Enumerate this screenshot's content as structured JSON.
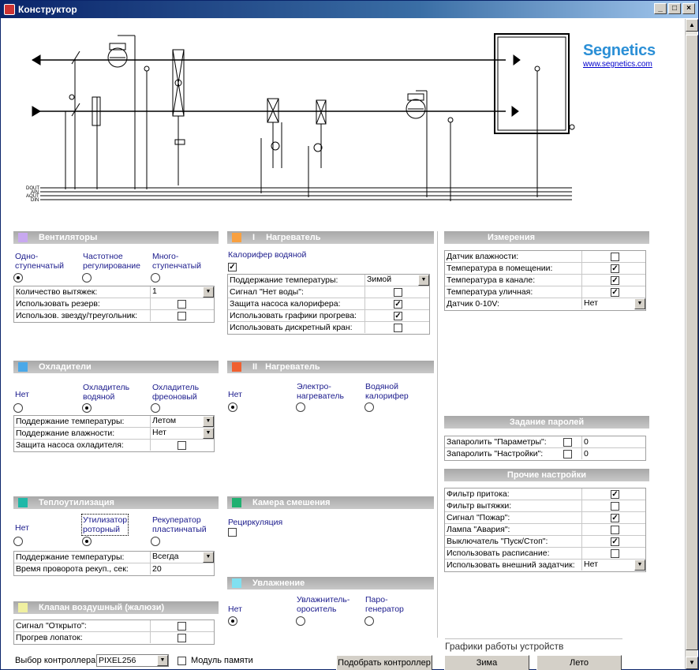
{
  "window": {
    "title": "Конструктор",
    "min": "_",
    "max": "□",
    "close": "×"
  },
  "brand": {
    "name": "Segnetics",
    "url": "www.segnetics.com"
  },
  "schema": {
    "bus_labels": [
      "DOUT",
      "AIN",
      "AOUT",
      "DIN"
    ]
  },
  "fans": {
    "title": "Вентиляторы",
    "color": "#c8a8f0",
    "options": [
      "Одно-\nступенчатый",
      "Частотное\nрегулирование",
      "Много-\nступенчатый"
    ],
    "rows": [
      {
        "label": "Количество вытяжек:",
        "value": "1"
      },
      {
        "label": "Использовать резерв:"
      },
      {
        "label": "Использов. звезду/треугольник:"
      }
    ]
  },
  "coolers": {
    "title": "Охладители",
    "color": "#4aa8e8",
    "options": [
      "Нет",
      "Охладитель\nводяной",
      "Охладитель\nфреоновый"
    ],
    "rows": [
      {
        "label": "Поддержание температуры:",
        "value": "Летом"
      },
      {
        "label": "Поддержание влажности:",
        "value": "Нет"
      },
      {
        "label": "Защита насоса охладителя:"
      }
    ]
  },
  "heatrec": {
    "title": "Теплоутилизация",
    "color": "#20b8a8",
    "options": [
      "Нет",
      "Утилизатор\nроторный",
      "Рекуператор\nпластинчатый"
    ],
    "rows": [
      {
        "label": "Поддержание температуры:",
        "value": "Всегда"
      },
      {
        "label": "Время проворота рекуп., сек:",
        "value": "20"
      }
    ]
  },
  "damper": {
    "title": "Клапан воздушный (жалюзи)",
    "color": "#f0f0a0",
    "rows": [
      {
        "label": "Сигнал \"Открыто\":"
      },
      {
        "label": "Прогрев лопаток:"
      }
    ]
  },
  "heater1": {
    "num": "I",
    "title": "Нагреватель",
    "color": "#f8a040",
    "sub": "Калорифер водяной",
    "rows": [
      {
        "label": "Поддержание температуры:",
        "value": "Зимой"
      },
      {
        "label": "Сигнал \"Нет воды\":"
      },
      {
        "label": "Защита насоса калорифера:"
      },
      {
        "label": "Использовать графики прогрева:"
      },
      {
        "label": "Использовать дискретный кран:"
      }
    ]
  },
  "heater2": {
    "num": "II",
    "title": "Нагреватель",
    "color": "#f06030",
    "options": [
      "Нет",
      "Электро-\nнагреватель",
      "Водяной\nкалорифер"
    ]
  },
  "mixing": {
    "title": "Камера смешения",
    "color": "#20b070",
    "sub": "Рециркуляция"
  },
  "humid": {
    "title": "Увлажнение",
    "color": "#80e0f0",
    "options": [
      "Нет",
      "Увлажнитель-\nороситель",
      "Паро-\nгенератор"
    ]
  },
  "measure": {
    "title": "Измерения",
    "rows": [
      {
        "label": "Датчик влажности:"
      },
      {
        "label": "Температура в помещении:"
      },
      {
        "label": "Температура в канале:"
      },
      {
        "label": "Температура уличная:"
      },
      {
        "label": "Датчик 0-10V:",
        "value": "Нет"
      }
    ]
  },
  "passwords": {
    "title": "Задание паролей",
    "rows": [
      {
        "label": "Запаролить \"Параметры\":",
        "value": "0"
      },
      {
        "label": "Запаролить \"Настройки\":",
        "value": "0"
      }
    ]
  },
  "other": {
    "title": "Прочие настройки",
    "rows": [
      {
        "label": "Фильтр притока:"
      },
      {
        "label": "Фильтр вытяжки:"
      },
      {
        "label": "Сигнал \"Пожар\":"
      },
      {
        "label": "Лампа \"Авария\":"
      },
      {
        "label": "Выключатель \"Пуск/Стоп\":"
      },
      {
        "label": "Использовать расписание:"
      },
      {
        "label": "Использовать внешний задатчик:",
        "value": "Нет"
      }
    ]
  },
  "bottom": {
    "controller_label": "Выбор контроллера:",
    "controller_value": "PIXEL256",
    "memory_label": "Модуль памяти",
    "pick_button": "Подобрать контроллер",
    "charts_caption": "Графики работы устройств",
    "winter_button": "Зима",
    "summer_button": "Лето"
  }
}
